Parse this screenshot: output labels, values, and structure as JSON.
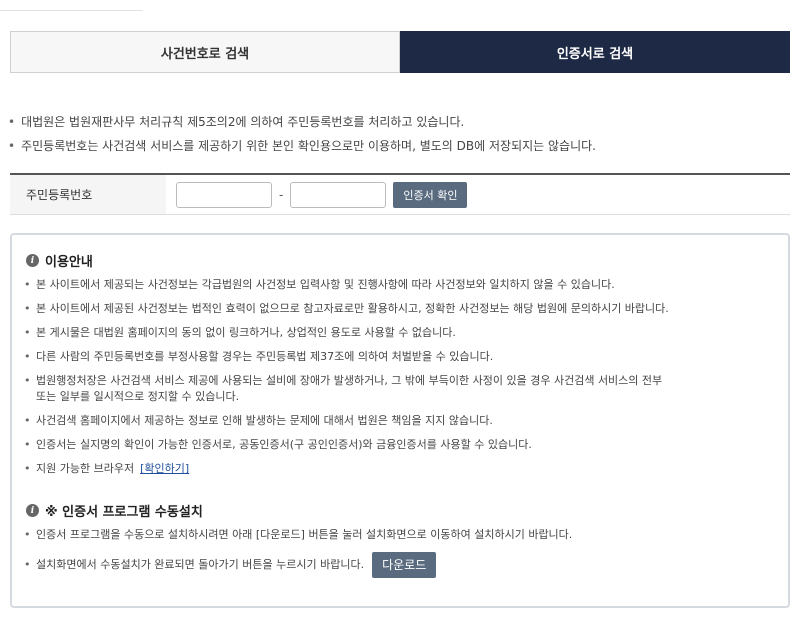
{
  "tabs": [
    {
      "label": "사건번호로 검색",
      "active": false
    },
    {
      "label": "인증서로 검색",
      "active": true
    }
  ],
  "notices": [
    "대법원은 법원재판사무 처리규칙 제5조의2에 의하여 주민등록번호를 처리하고 있습니다.",
    "주민등록번호는 사건검색 서비스를 제공하기 위한 본인 확인용으로만 이용하며, 별도의 DB에 저장되지는 않습니다."
  ],
  "id_form": {
    "label": "주민등록번호",
    "first_value": "",
    "second_value": "",
    "separator": "-",
    "confirm_label": "인증서 확인"
  },
  "guide": {
    "title": "이용안내",
    "items": [
      "본 사이트에서 제공되는 사건정보는 각급법원의 사건정보 입력사항 및 진행사항에 따라 사건정보와 일치하지 않을 수 있습니다.",
      "본 사이트에서 제공된 사건정보는 법적인 효력이 없으므로 참고자료로만 활용하시고, 정확한 사건정보는 해당 법원에 문의하시기 바랍니다.",
      "본 게시물은 대법원 홈페이지의 동의 없이 링크하거나, 상업적인 용도로 사용할 수 없습니다.",
      "다른 사람의 주민등록번호를 부정사용할 경우는 주민등록법 제37조에 의하여 처벌받을 수 있습니다.",
      "법원행정처장은 사건검색 서비스 제공에 사용되는 설비에 장애가 발생하거나, 그 밖에 부득이한 사정이 있을 경우 사건검색 서비스의 전부",
      "또는 일부를 일시적으로 정지할 수 있습니다.",
      "사건검색 홈페이지에서 제공하는 정보로 인해 발생하는 문제에 대해서 법원은 책임을 지지 않습니다.",
      "인증서는 실지명의 확인이 가능한 인증서로, 공동인증서(구 공인인증서)와 금융인증서를 사용할 수 있습니다."
    ],
    "browser_text": "지원 가능한 브라우저",
    "browser_link": "[확인하기]"
  },
  "install": {
    "title": "※ 인증서 프로그램 수동설치",
    "item1": "인증서 프로그램을 수동으로 설치하시려면 아래 [다운로드] 버튼을 눌러 설치화면으로 이동하여 설치하시기 바랍니다.",
    "item2": "설치화면에서 수동설치가 완료되면 돌아가기 버튼을 누르시기 바랍니다.",
    "download_label": "다운로드"
  }
}
